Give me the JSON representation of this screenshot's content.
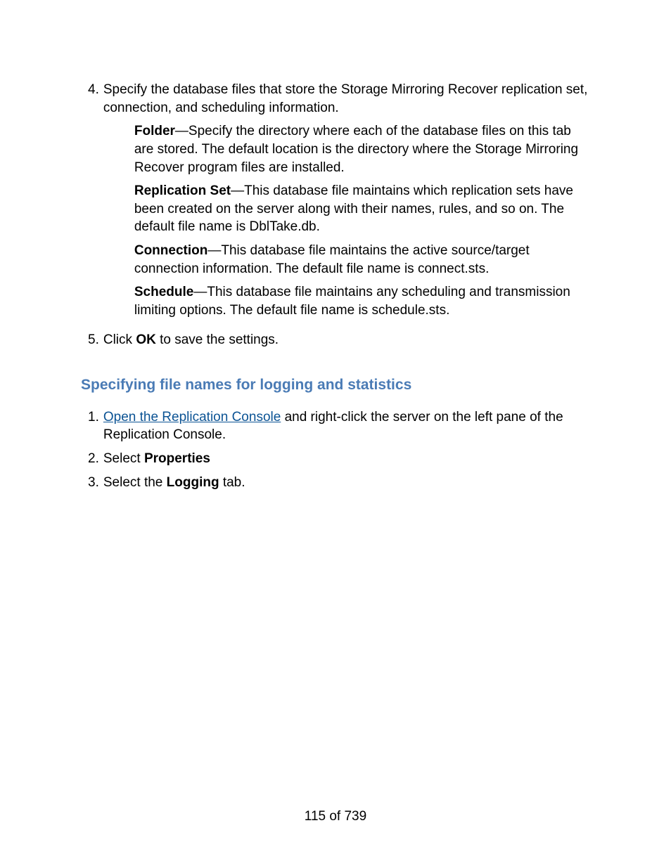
{
  "list1": {
    "item4_num": "4.",
    "item4_text": "Specify the database files that store the Storage Mirroring Recover replication set, connection, and scheduling information.",
    "folder_label": "Folder",
    "folder_text": "—Specify the directory where each of the database files on this tab are stored. The default location is the directory where the Storage Mirroring Recover program files are installed.",
    "replset_label": "Replication Set",
    "replset_text": "—This database file maintains which replication sets have been created on the server along with their names, rules, and so on. The default file name is DblTake.db.",
    "connection_label": "Connection",
    "connection_text": "—This database file maintains the active source/target connection information. The default file name is connect.sts.",
    "schedule_label": "Schedule",
    "schedule_text": "—This database file maintains any scheduling and transmission limiting options. The default file name is schedule.sts.",
    "item5_num": "5.",
    "item5_pre": "Click ",
    "item5_bold": "OK",
    "item5_post": " to save the settings."
  },
  "heading": "Specifying file names for logging and statistics",
  "list2": {
    "item1_num": "1.",
    "item1_link": "Open the Replication Console",
    "item1_post": " and right-click the server on the left pane of the Replication Console.",
    "item2_num": "2.",
    "item2_pre": "Select ",
    "item2_bold": "Properties",
    "item3_num": "3.",
    "item3_pre": "Select the ",
    "item3_bold": "Logging",
    "item3_post": " tab."
  },
  "page_number": "115 of 739"
}
